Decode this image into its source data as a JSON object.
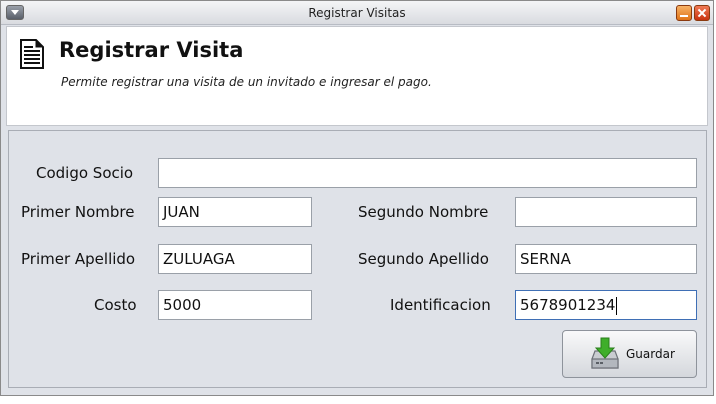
{
  "window": {
    "title": "Registrar Visitas"
  },
  "header": {
    "title": "Registrar Visita",
    "subtitle": "Permite registrar una visita de un invitado e ingresar el pago.",
    "icon": "document-icon"
  },
  "form": {
    "codigo_socio": {
      "label": "Codigo Socio",
      "value": ""
    },
    "primer_nombre": {
      "label": "Primer Nombre",
      "value": "JUAN"
    },
    "segundo_nombre": {
      "label": "Segundo Nombre",
      "value": ""
    },
    "primer_apellido": {
      "label": "Primer Apellido",
      "value": "ZULUAGA"
    },
    "segundo_apellido": {
      "label": "Segundo Apellido",
      "value": "SERNA"
    },
    "costo": {
      "label": "Costo",
      "value": "5000"
    },
    "identificacion": {
      "label": "Identificacion",
      "value": "5678901234"
    }
  },
  "actions": {
    "save_label": "Guardar",
    "save_icon": "save-download-icon"
  },
  "colors": {
    "focus_border": "#3f6fb5",
    "save_arrow": "#3fae2a"
  }
}
